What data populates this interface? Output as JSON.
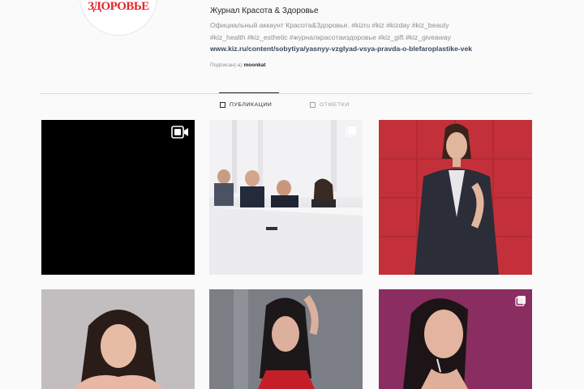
{
  "profile": {
    "logo_text": "ЗДОРОВЬЕ",
    "name": "Журнал Красота & Здоровье",
    "bio_line1": "Официальный аккаунт Красота&Здоровье. #kizru #kiz #kizday #kiz_beauty",
    "bio_line2": "#kiz_health #kiz_esthetic #журналкрасотаиздоровье #kiz_gift #kiz_giveaway",
    "link": "www.kiz.ru/content/sobytiya/yasnyy-vzglyad-vsya-pravda-o-blefaroplastike-vek",
    "followed_prefix": "Подписан(-а)",
    "followed_user": "moonkat"
  },
  "tabs": {
    "posts_label": "ПУБЛИКАЦИИ",
    "tagged_label": "ОТМЕТКИ"
  },
  "grid": {
    "tiles": [
      {
        "kind": "video",
        "badge_icon": "video-camera-icon"
      },
      {
        "kind": "photo",
        "badge_icon": "carousel-icon"
      },
      {
        "kind": "photo",
        "badge_icon": ""
      },
      {
        "kind": "photo",
        "badge_icon": ""
      },
      {
        "kind": "photo",
        "badge_icon": ""
      },
      {
        "kind": "photo",
        "badge_icon": "carousel-icon"
      }
    ]
  },
  "colors": {
    "brand_red": "#e0262e",
    "text": "#262626",
    "muted": "#8e8e8e",
    "link": "#3a4a5e"
  }
}
